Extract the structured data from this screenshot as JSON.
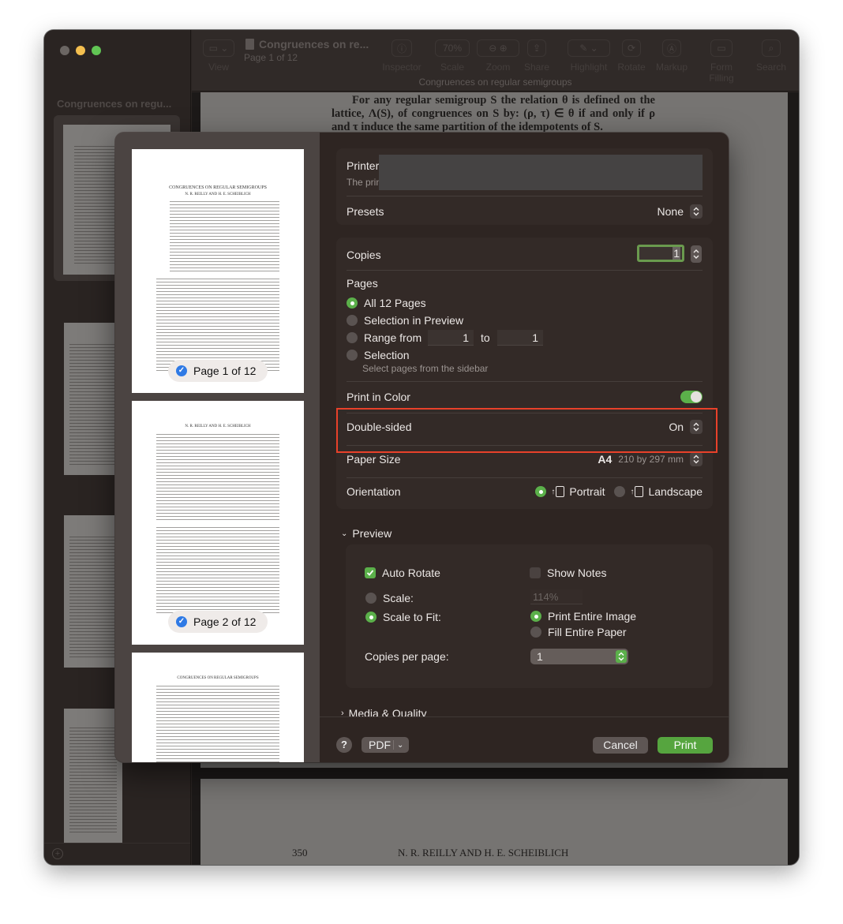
{
  "window": {
    "title": "Congruences on re...",
    "page_indicator": "Page 1 of 12",
    "subtitle": "Congruences on regular semigroups"
  },
  "sidebar": {
    "title": "Congruences on regu..."
  },
  "toolbar": {
    "items": [
      {
        "label": "View",
        "icon": "sidebar-toggle-icon"
      },
      {
        "label": "Inspector",
        "icon": "info-icon"
      },
      {
        "label": "Scale",
        "value": "70%"
      },
      {
        "label": "Zoom",
        "icon": "zoom-icon"
      },
      {
        "label": "Share",
        "icon": "share-icon"
      },
      {
        "label": "Highlight",
        "icon": "highlight-icon"
      },
      {
        "label": "Rotate",
        "icon": "rotate-icon"
      },
      {
        "label": "Markup",
        "icon": "markup-icon"
      },
      {
        "label": "Form Filling",
        "icon": "form-filling-icon"
      },
      {
        "label": "Search",
        "icon": "search-icon"
      }
    ]
  },
  "document": {
    "paragraph": "For any regular semigroup S the relation θ is defined on the lattice, Λ(S), of congruences on S by: (ρ, τ) ∈ θ if and only if ρ and τ induce the same partition of the idempotents of S.",
    "footer_page_number": "350",
    "footer_authors": "N. R. REILLY AND H. E. SCHEIBLICH"
  },
  "print_dialog": {
    "preview_pages": [
      {
        "heading": "CONGRUENCES ON REGULAR SEMIGROUPS",
        "subheading": "N. R. REILLY AND H. E. SCHEIBLICH",
        "badge": "Page 1 of 12",
        "checked": true
      },
      {
        "heading": "N. R. REILLY AND H. E. SCHEIBLICH",
        "badge": "Page 2 of 12",
        "checked": true
      },
      {
        "heading": "CONGRUENCES ON REGULAR SEMIGROUPS"
      }
    ],
    "printer": {
      "label": "Printer",
      "description": "The prin"
    },
    "presets": {
      "label": "Presets",
      "value": "None"
    },
    "copies": {
      "label": "Copies",
      "value": "1"
    },
    "pages": {
      "label": "Pages",
      "options": [
        {
          "label": "All 12 Pages",
          "selected": true
        },
        {
          "label": "Selection in Preview",
          "selected": false
        },
        {
          "label": "Range from",
          "selected": false
        },
        {
          "label": "Selection",
          "selected": false
        }
      ],
      "range_from": "1",
      "range_to_label": "to",
      "range_to": "1",
      "selection_hint": "Select pages from the sidebar"
    },
    "print_in_color": {
      "label": "Print in Color",
      "on": true
    },
    "double_sided": {
      "label": "Double-sided",
      "value": "On"
    },
    "paper_size": {
      "label": "Paper Size",
      "value": "A4",
      "detail": "210 by 297 mm"
    },
    "orientation": {
      "label": "Orientation",
      "options": [
        {
          "label": "Portrait",
          "selected": true
        },
        {
          "label": "Landscape",
          "selected": false
        }
      ]
    },
    "preview_section": {
      "title": "Preview",
      "auto_rotate": {
        "label": "Auto Rotate",
        "checked": true
      },
      "show_notes": {
        "label": "Show Notes",
        "checked": false
      },
      "scale": {
        "label": "Scale:",
        "selected": false,
        "value": "114%"
      },
      "scale_to_fit": {
        "label": "Scale to Fit:",
        "selected": true
      },
      "print_entire_image": {
        "label": "Print Entire Image",
        "selected": true
      },
      "fill_entire_paper": {
        "label": "Fill Entire Paper",
        "selected": false
      },
      "copies_per_page": {
        "label": "Copies per page:",
        "value": "1"
      }
    },
    "media_quality": {
      "title": "Media & Quality"
    },
    "footer": {
      "help": "?",
      "pdf": "PDF",
      "cancel": "Cancel",
      "print": "Print"
    }
  },
  "colors": {
    "accent_green": "#5bb04a",
    "highlight_red": "#e8412a",
    "checkbox_blue": "#2f7ae5"
  }
}
